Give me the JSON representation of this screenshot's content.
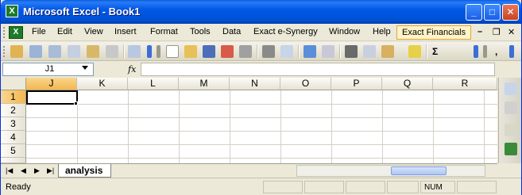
{
  "window": {
    "title": "Microsoft Excel - Book1",
    "app_icon_letter": "X",
    "minimize": "_",
    "maximize": "□",
    "close": "✕"
  },
  "menubar": {
    "items": [
      {
        "label": "File"
      },
      {
        "label": "Edit"
      },
      {
        "label": "View"
      },
      {
        "label": "Insert"
      },
      {
        "label": "Format"
      },
      {
        "label": "Tools"
      },
      {
        "label": "Data"
      },
      {
        "label": "Exact e-Synergy"
      },
      {
        "label": "Window"
      },
      {
        "label": "Help"
      },
      {
        "label": "Exact Financials"
      }
    ],
    "doc_minimize": "–",
    "doc_restore": "❐",
    "doc_close": "✕"
  },
  "toolbar": {
    "sigma": "Σ",
    "comma": ","
  },
  "formula": {
    "name_box": "J1",
    "fx": "fx",
    "value": ""
  },
  "grid": {
    "columns": [
      "J",
      "K",
      "L",
      "M",
      "N",
      "O",
      "P",
      "Q",
      "R"
    ],
    "rows": [
      "1",
      "2",
      "3",
      "4",
      "5"
    ],
    "selected_column": "J",
    "selected_row": "1"
  },
  "sheets": {
    "nav_first": "|◀",
    "nav_prev": "◀",
    "nav_next": "▶",
    "nav_last": "▶|",
    "active_tab": "analysis"
  },
  "status": {
    "text": "Ready",
    "num": "NUM"
  },
  "colors": {
    "title_bar": "#0058e6",
    "selection_header": "#f4b74e",
    "active_menu": "#fff3c8"
  }
}
